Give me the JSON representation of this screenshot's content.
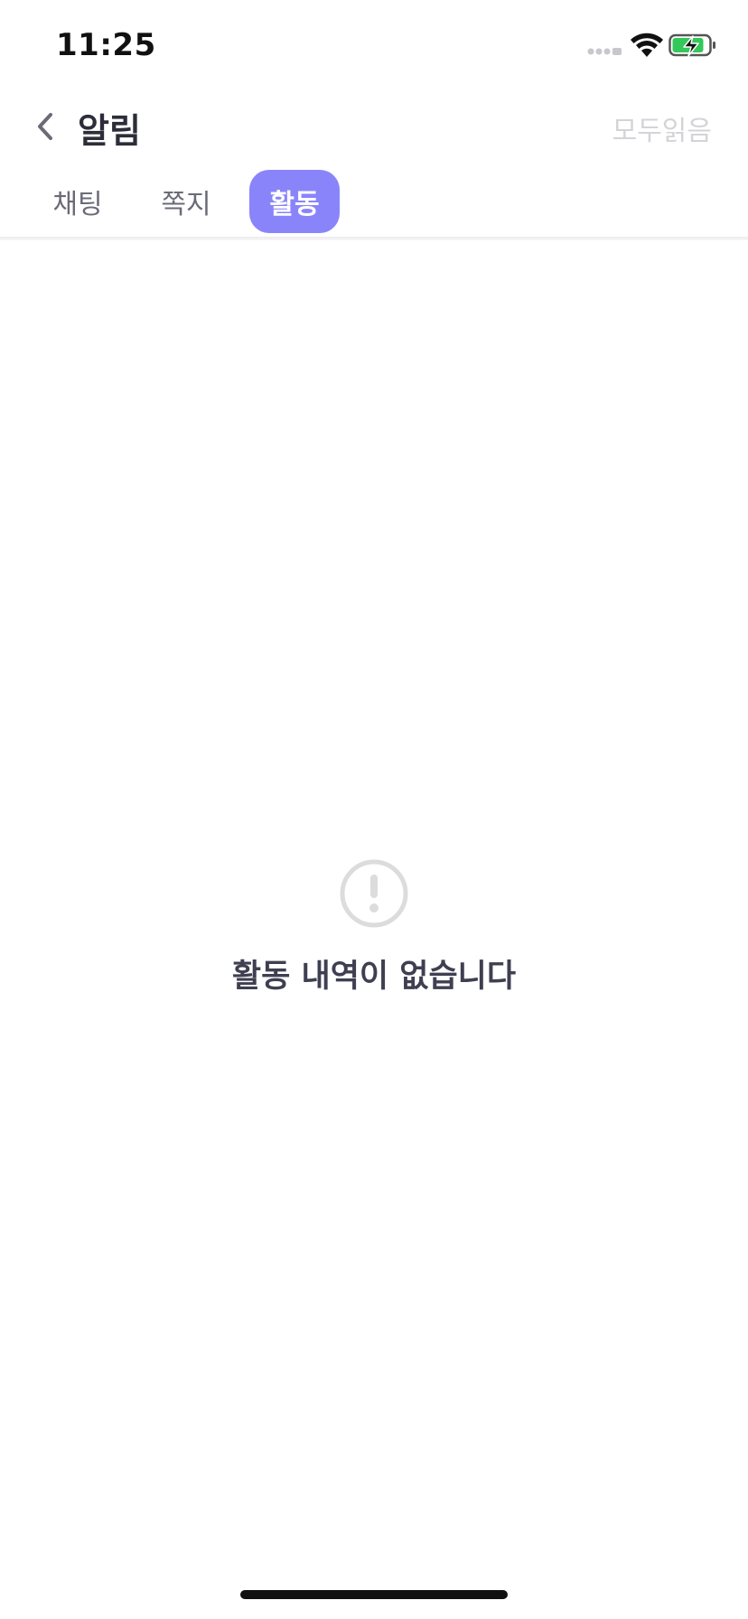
{
  "status_bar": {
    "time": "11:25",
    "icons": [
      "signal-icon",
      "wifi-icon",
      "battery-charging-icon"
    ],
    "battery_color": "#34c759"
  },
  "header": {
    "back_icon": "chevron-left-icon",
    "title": "알림",
    "mark_all_read": "모두읽음"
  },
  "tabs": [
    {
      "label": "채팅",
      "active": false
    },
    {
      "label": "쪽지",
      "active": false
    },
    {
      "label": "활동",
      "active": true
    }
  ],
  "colors": {
    "accent": "#8a84fb",
    "title": "#2d2d3a",
    "tab_inactive": "#6b6b78",
    "disabled_text": "#d4d4d8",
    "empty_text": "#3f3f52",
    "icon_gray": "#dcdcdc"
  },
  "empty_state": {
    "icon": "exclamation-circle-icon",
    "message": "활동 내역이 없습니다"
  }
}
